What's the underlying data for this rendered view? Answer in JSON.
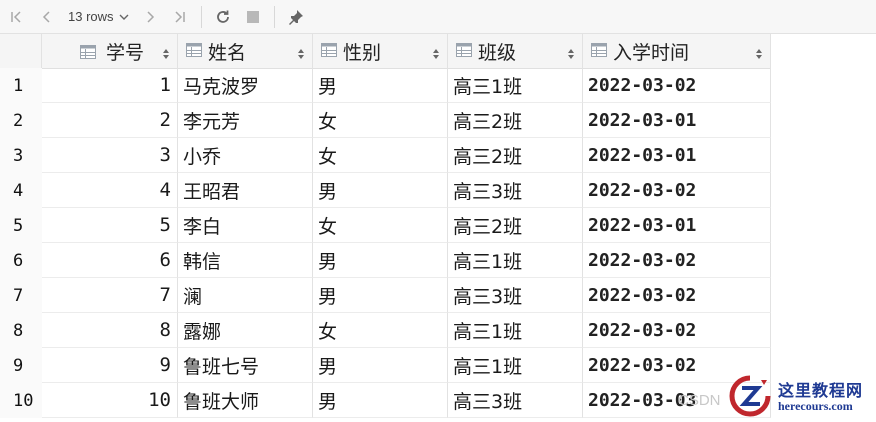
{
  "toolbar": {
    "rows_label": "13 rows",
    "icons": [
      "first-page-icon",
      "prev-page-icon",
      "chevron-down-icon",
      "next-page-icon",
      "last-page-icon",
      "refresh-icon",
      "stop-icon",
      "pin-icon"
    ]
  },
  "table": {
    "columns": [
      {
        "key": "id",
        "label": "学号"
      },
      {
        "key": "name",
        "label": "姓名"
      },
      {
        "key": "sex",
        "label": "性别"
      },
      {
        "key": "cls",
        "label": "班级"
      },
      {
        "key": "date",
        "label": "入学时间"
      }
    ],
    "rows": [
      {
        "n": "1",
        "id": "1",
        "name": "马克波罗",
        "sex": "男",
        "cls": "高三1班",
        "date": "2022-03-02"
      },
      {
        "n": "2",
        "id": "2",
        "name": "李元芳",
        "sex": "女",
        "cls": "高三2班",
        "date": "2022-03-01"
      },
      {
        "n": "3",
        "id": "3",
        "name": "小乔",
        "sex": "女",
        "cls": "高三2班",
        "date": "2022-03-01"
      },
      {
        "n": "4",
        "id": "4",
        "name": "王昭君",
        "sex": "男",
        "cls": "高三3班",
        "date": "2022-03-02"
      },
      {
        "n": "5",
        "id": "5",
        "name": "李白",
        "sex": "女",
        "cls": "高三2班",
        "date": "2022-03-01"
      },
      {
        "n": "6",
        "id": "6",
        "name": "韩信",
        "sex": "男",
        "cls": "高三1班",
        "date": "2022-03-02"
      },
      {
        "n": "7",
        "id": "7",
        "name": "澜",
        "sex": "男",
        "cls": "高三3班",
        "date": "2022-03-02"
      },
      {
        "n": "8",
        "id": "8",
        "name": "露娜",
        "sex": "女",
        "cls": "高三1班",
        "date": "2022-03-02"
      },
      {
        "n": "9",
        "id": "9",
        "name": "鲁班七号",
        "sex": "男",
        "cls": "高三1班",
        "date": "2022-03-02"
      },
      {
        "n": "10",
        "id": "10",
        "name": "鲁班大师",
        "sex": "男",
        "cls": "高三3班",
        "date": "2022-03-03"
      }
    ]
  },
  "watermark": {
    "csdn": "CSDN",
    "site_name": "这里教程网",
    "site_url": "herecours.com"
  },
  "colors": {
    "icon_gray": "#a8a8a8",
    "header_bg": "#f5f5f5",
    "brand_blue": "#1f3a93",
    "brand_red": "#c0272d"
  }
}
